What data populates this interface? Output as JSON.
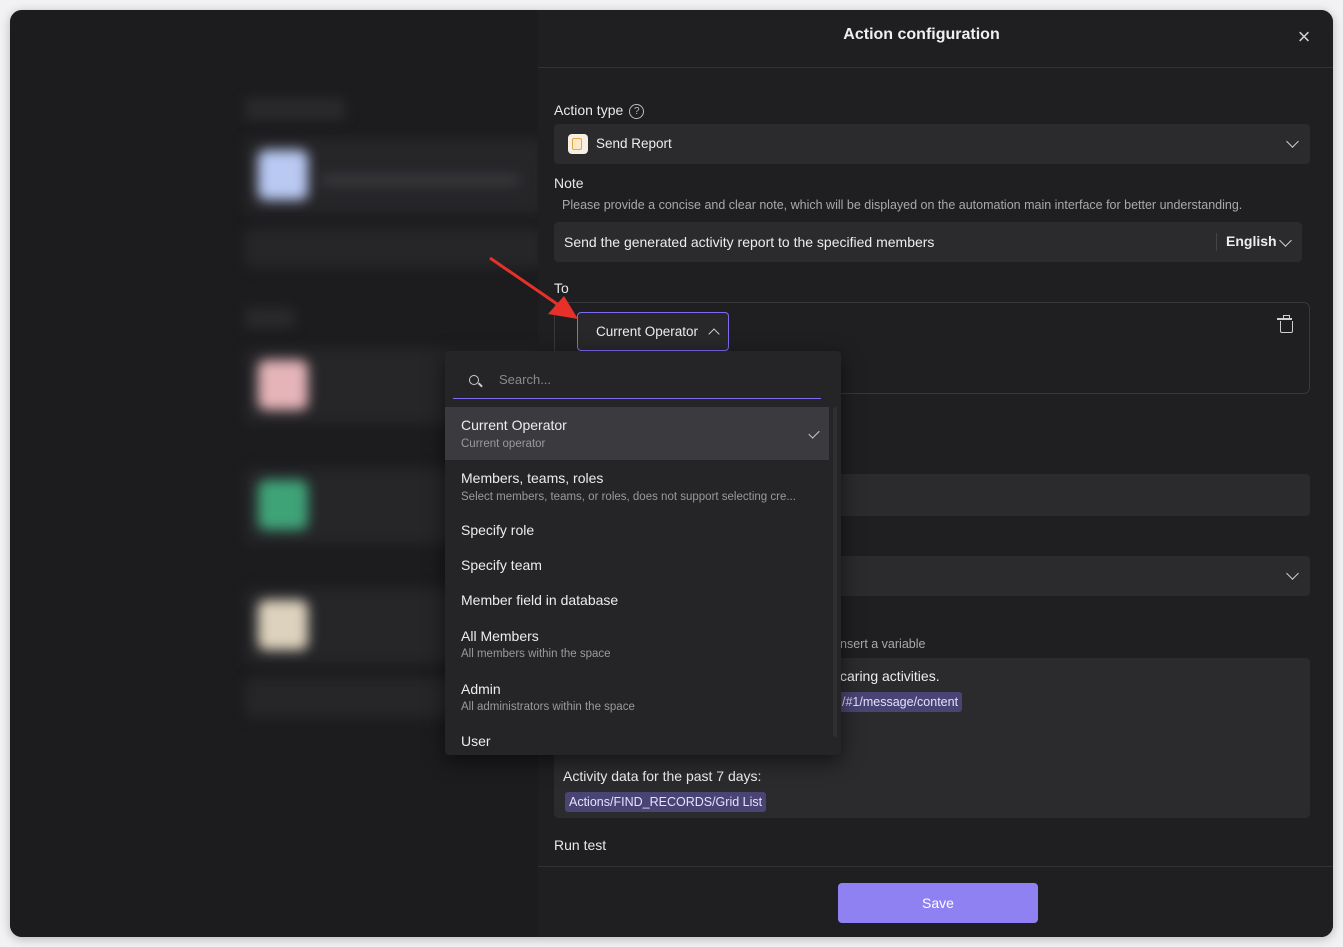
{
  "panel": {
    "title": "Action configuration",
    "action_type": {
      "label": "Action type",
      "value": "Send Report"
    },
    "note": {
      "label": "Note",
      "hint": "Please provide a concise and clear note, which will be displayed on the automation main interface for better understanding.",
      "value": "Send the generated activity report to the specified members",
      "language": "English"
    },
    "to": {
      "label": "To",
      "selected": "Current Operator"
    },
    "partial": {
      "insert_variable_hint": "nsert a variable",
      "caring_text": "caring activities.",
      "message_chip": "/#1/message/content",
      "activity_text": "Activity data for the past 7 days:",
      "records_chip": "Actions/FIND_RECORDS/Grid List"
    },
    "run_test": {
      "label": "Run test"
    },
    "save_label": "Save"
  },
  "dropdown": {
    "search_placeholder": "Search...",
    "options": [
      {
        "title": "Current Operator",
        "subtitle": "Current operator",
        "selected": true
      },
      {
        "title": "Members, teams, roles",
        "subtitle": "Select members, teams, or roles, does not support selecting cre..."
      },
      {
        "title": "Specify role"
      },
      {
        "title": "Specify team"
      },
      {
        "title": "Member field in database"
      },
      {
        "title": "All Members",
        "subtitle": "All members within the space"
      },
      {
        "title": "Admin",
        "subtitle": "All administrators within the space"
      },
      {
        "title": "User"
      }
    ]
  },
  "colors": {
    "accent": "#8f81f2",
    "arrow": "#e8302b",
    "chip_bg": "#4a4474"
  }
}
